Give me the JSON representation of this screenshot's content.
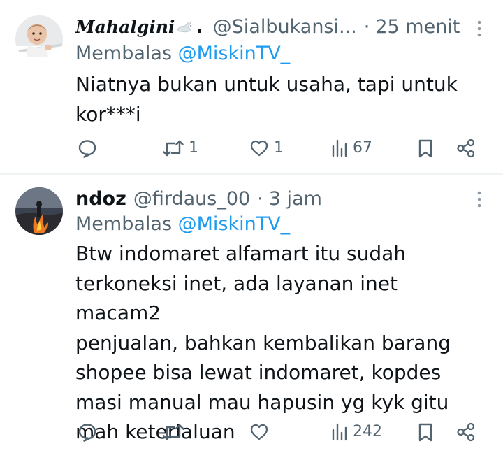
{
  "tweets": [
    {
      "display_name": "Mahalgini",
      "name_suffix": ".",
      "handle": "@Sialbukansi...",
      "separator": "·",
      "time": "25 menit",
      "reply_prefix": "Membalas",
      "reply_to": "@MiskinTV_",
      "text": "Niatnya bukan untuk usaha, tapi untuk\nkor***i",
      "counts": {
        "reply": "",
        "retweet": "1",
        "like": "1",
        "views": "67"
      }
    },
    {
      "display_name": "ndoz",
      "handle": "@firdaus_00",
      "separator": "·",
      "time": "3 jam",
      "reply_prefix": "Membalas",
      "reply_to": "@MiskinTV_",
      "text": "Btw indomaret alfamart itu sudah\nterkoneksi inet, ada layanan inet macam2\npenjualan, bahkan kembalikan barang\nshopee bisa lewat indomaret, kopdes\nmasi manual mau hapusin yg kyk gitu\nmah  keterlaluan",
      "counts": {
        "reply": "",
        "retweet": "",
        "like": "",
        "views": "242"
      }
    }
  ],
  "icons": {
    "more": "more-vertical-icon",
    "reply": "reply-icon",
    "retweet": "retweet-icon",
    "like": "heart-icon",
    "views": "views-chart-icon",
    "bookmark": "bookmark-icon",
    "share": "share-icon",
    "dove": "dove-emoji-icon"
  },
  "colors": {
    "text": "#0f1419",
    "secondary": "#536471",
    "link": "#1d9bf0",
    "divider": "#eff3f4"
  }
}
